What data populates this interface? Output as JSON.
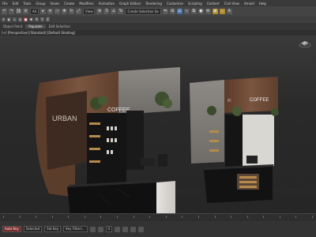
{
  "menubar": [
    "File",
    "Edit",
    "Tools",
    "Group",
    "Views",
    "Create",
    "Modifiers",
    "Animation",
    "Graph Editors",
    "Rendering",
    "Customize",
    "Scripting",
    "Content",
    "Civil View",
    "Arnold",
    "Help"
  ],
  "toolbar": {
    "selection_filter": "All",
    "view_dropdown": "View",
    "selection_set": "Create Selection Se"
  },
  "ribbon": {
    "tabs": [
      "Object Paint",
      "Populate"
    ],
    "active": "Populate",
    "sub": "Edit Selection"
  },
  "viewport": {
    "label": "[+] [Perspective] [Standard] [Default Shading]"
  },
  "scene": {
    "left_sign_1": "URBAN",
    "left_sign_2": "COFFEE",
    "right_sign": "COFFEE"
  },
  "status": {
    "auto_key": "Auto Key",
    "selected": "Selected",
    "set_key": "Set Key",
    "key_filters": "Key Filters...",
    "frame": "0"
  },
  "colors": {
    "wood": "#6b4a36",
    "concrete": "#8a8681",
    "counter": "#121212",
    "marble": "#d8d6d2"
  }
}
